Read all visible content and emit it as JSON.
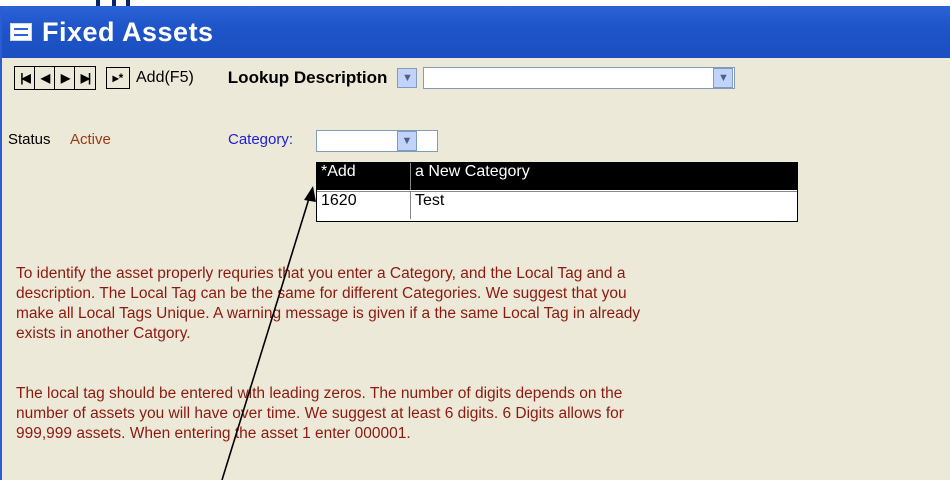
{
  "window": {
    "title": "Fixed Assets",
    "title_icon": "form-icon",
    "accent": "#1f55c9"
  },
  "toolbar": {
    "nav_first": "|◀",
    "nav_prev": "◀",
    "nav_next": "▶",
    "nav_last": "▶|",
    "new_record": "▸*",
    "add_label": "Add(F5)",
    "lookup_label": "Lookup Description",
    "lookup_value": ""
  },
  "form": {
    "status_label": "Status",
    "status_value": "Active",
    "category_label": "Category:",
    "category_value": ""
  },
  "dropdown": {
    "rows": [
      {
        "code": "*Add",
        "name": "a New Category",
        "selected": true
      },
      {
        "code": "1620",
        "name": "Test",
        "selected": false
      }
    ]
  },
  "info": {
    "paragraph1": [
      "To identify the asset properly requries that you enter a Category,  and the Local Tag and a",
      "description.  The Local Tag can be the same for different Categories.  We suggest that you",
      "make all Local Tags Unique.   A warning message is given if a the same Local Tag in already",
      "exists in another Catgory."
    ],
    "paragraph2": [
      "The local tag should be entered with leading zeros.  The number of digits depends on the",
      "number of assets you will have over time.   We suggest at least 6 digits.   6 Digits allows for",
      "999,999 assets.  When entering the asset 1 enter 000001."
    ]
  }
}
